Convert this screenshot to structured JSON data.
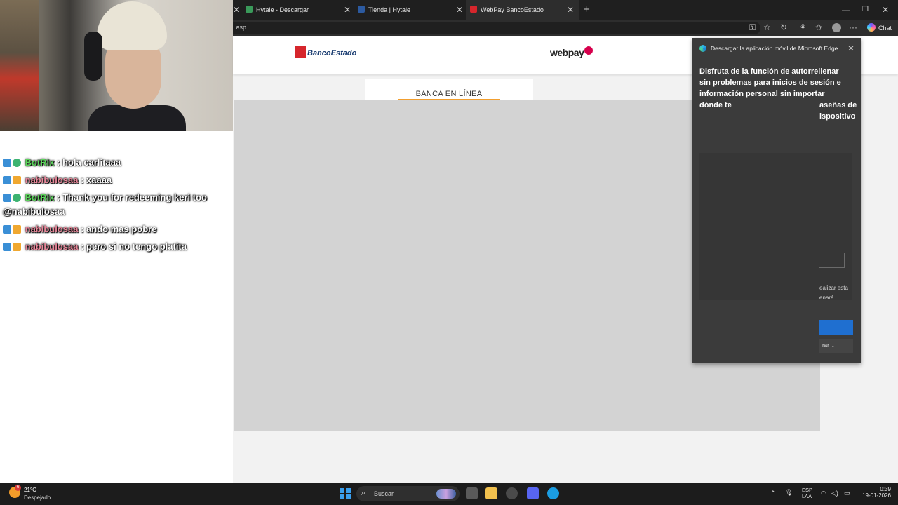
{
  "browser": {
    "tabs": [
      {
        "label": "Hytale - Descargar",
        "favicon_color": "#3a9a5a"
      },
      {
        "label": "Tienda | Hytale",
        "favicon_color": "#2c5aa0"
      },
      {
        "label": "WebPay BancoEstado",
        "favicon_color": "#d6262c"
      }
    ],
    "url": ".asp",
    "chat_label": "Chat",
    "window_controls": {
      "minimize": "—",
      "restore": "❐",
      "close": "✕"
    }
  },
  "chat": {
    "messages": [
      {
        "user": "BotRix",
        "text": ": hola carlitaaa"
      },
      {
        "user": "nabibulosaa",
        "text": ": xaaaa"
      },
      {
        "user": "BotRix",
        "text": ": Thank you for redeeming keri too @nabibulosaa"
      },
      {
        "user": "nabibulosaa",
        "text": ": ando mas pobre"
      },
      {
        "user": "nabibulosaa",
        "text": ": pero si no tengo platita"
      }
    ]
  },
  "site": {
    "bank_logo": "BancoEstado",
    "webpay_logo": "webpay",
    "card_title": "BANCA EN LÍNEA"
  },
  "edge_popup": {
    "header": "Descargar la aplicación móvil de Microsoft Edge",
    "body": "Disfruta de la función de autorrellenar sin problemas para inicios de sesión e información personal sin importar dónde te",
    "body_partial_lines": [
      "aseñas de",
      "ispositivo"
    ],
    "small_text_lines": [
      "ealizar esta",
      "enará."
    ],
    "button2_partial": "rar"
  },
  "taskbar": {
    "weather_temp": "21°C",
    "weather_desc": "Despejado",
    "weather_badge": "6",
    "search_placeholder": "Buscar",
    "lang_top": "ESP",
    "lang_bottom": "LAA",
    "time": "0:39",
    "date": "19-01-2026"
  },
  "colors": {
    "botrix": "#5cd65c",
    "nabibulosaa": "#e8879a",
    "accent_orange": "#f29f2f",
    "edge_blue": "#1f6fd0"
  }
}
